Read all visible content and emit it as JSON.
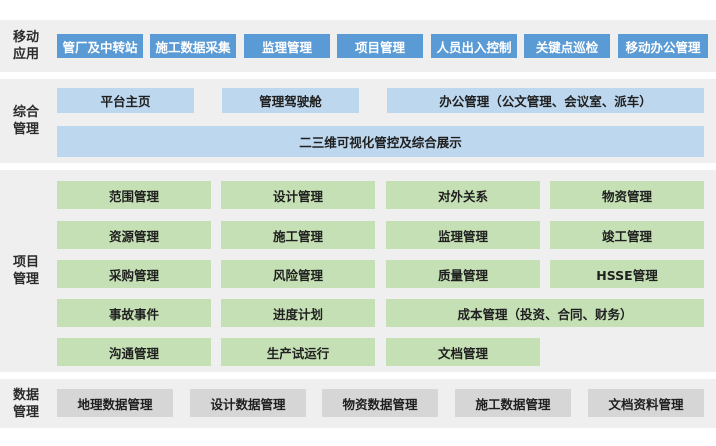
{
  "sections": {
    "mobile": {
      "title": "移动\n应用",
      "items": [
        "管厂及中转站",
        "施工数据采集",
        "监理管理",
        "项目管理",
        "人员出入控制",
        "关键点巡检",
        "移动办公管理"
      ]
    },
    "integrated": {
      "title": "综合\n管理",
      "items": [
        "平台主页",
        "管理驾驶舱",
        "办公管理（公文管理、会议室、派车）",
        "二三维可视化管控及综合展示"
      ]
    },
    "project": {
      "title": "项目\n管理",
      "items": [
        "范围管理",
        "设计管理",
        "对外关系",
        "物资管理",
        "资源管理",
        "施工管理",
        "监理管理",
        "竣工管理",
        "采购管理",
        "风险管理",
        "质量管理",
        "HSSE管理",
        "事故事件",
        "进度计划",
        "成本管理（投资、合同、财务）",
        "沟通管理",
        "生产试运行",
        "文档管理"
      ]
    },
    "data": {
      "title": "数据\n管理",
      "items": [
        "地理数据管理",
        "设计数据管理",
        "物资数据管理",
        "施工数据管理",
        "文档资料管理"
      ]
    }
  }
}
